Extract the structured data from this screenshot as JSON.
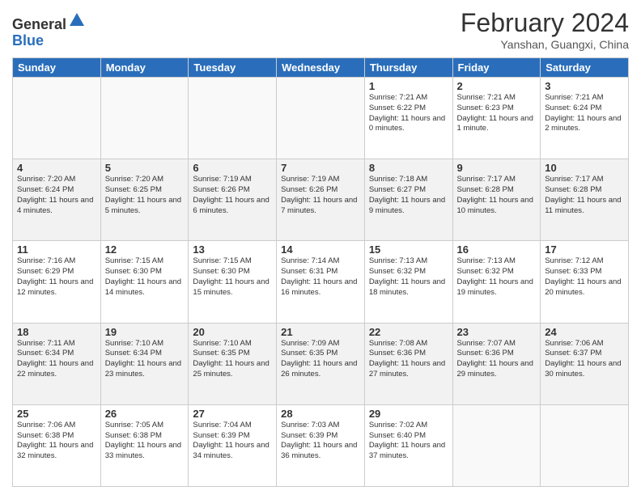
{
  "header": {
    "logo_line1": "General",
    "logo_line2": "Blue",
    "month_title": "February 2024",
    "subtitle": "Yanshan, Guangxi, China"
  },
  "weekdays": [
    "Sunday",
    "Monday",
    "Tuesday",
    "Wednesday",
    "Thursday",
    "Friday",
    "Saturday"
  ],
  "weeks": [
    [
      {
        "day": "",
        "info": ""
      },
      {
        "day": "",
        "info": ""
      },
      {
        "day": "",
        "info": ""
      },
      {
        "day": "",
        "info": ""
      },
      {
        "day": "1",
        "info": "Sunrise: 7:21 AM\nSunset: 6:22 PM\nDaylight: 11 hours and 0 minutes."
      },
      {
        "day": "2",
        "info": "Sunrise: 7:21 AM\nSunset: 6:23 PM\nDaylight: 11 hours and 1 minute."
      },
      {
        "day": "3",
        "info": "Sunrise: 7:21 AM\nSunset: 6:24 PM\nDaylight: 11 hours and 2 minutes."
      }
    ],
    [
      {
        "day": "4",
        "info": "Sunrise: 7:20 AM\nSunset: 6:24 PM\nDaylight: 11 hours and 4 minutes."
      },
      {
        "day": "5",
        "info": "Sunrise: 7:20 AM\nSunset: 6:25 PM\nDaylight: 11 hours and 5 minutes."
      },
      {
        "day": "6",
        "info": "Sunrise: 7:19 AM\nSunset: 6:26 PM\nDaylight: 11 hours and 6 minutes."
      },
      {
        "day": "7",
        "info": "Sunrise: 7:19 AM\nSunset: 6:26 PM\nDaylight: 11 hours and 7 minutes."
      },
      {
        "day": "8",
        "info": "Sunrise: 7:18 AM\nSunset: 6:27 PM\nDaylight: 11 hours and 9 minutes."
      },
      {
        "day": "9",
        "info": "Sunrise: 7:17 AM\nSunset: 6:28 PM\nDaylight: 11 hours and 10 minutes."
      },
      {
        "day": "10",
        "info": "Sunrise: 7:17 AM\nSunset: 6:28 PM\nDaylight: 11 hours and 11 minutes."
      }
    ],
    [
      {
        "day": "11",
        "info": "Sunrise: 7:16 AM\nSunset: 6:29 PM\nDaylight: 11 hours and 12 minutes."
      },
      {
        "day": "12",
        "info": "Sunrise: 7:15 AM\nSunset: 6:30 PM\nDaylight: 11 hours and 14 minutes."
      },
      {
        "day": "13",
        "info": "Sunrise: 7:15 AM\nSunset: 6:30 PM\nDaylight: 11 hours and 15 minutes."
      },
      {
        "day": "14",
        "info": "Sunrise: 7:14 AM\nSunset: 6:31 PM\nDaylight: 11 hours and 16 minutes."
      },
      {
        "day": "15",
        "info": "Sunrise: 7:13 AM\nSunset: 6:32 PM\nDaylight: 11 hours and 18 minutes."
      },
      {
        "day": "16",
        "info": "Sunrise: 7:13 AM\nSunset: 6:32 PM\nDaylight: 11 hours and 19 minutes."
      },
      {
        "day": "17",
        "info": "Sunrise: 7:12 AM\nSunset: 6:33 PM\nDaylight: 11 hours and 20 minutes."
      }
    ],
    [
      {
        "day": "18",
        "info": "Sunrise: 7:11 AM\nSunset: 6:34 PM\nDaylight: 11 hours and 22 minutes."
      },
      {
        "day": "19",
        "info": "Sunrise: 7:10 AM\nSunset: 6:34 PM\nDaylight: 11 hours and 23 minutes."
      },
      {
        "day": "20",
        "info": "Sunrise: 7:10 AM\nSunset: 6:35 PM\nDaylight: 11 hours and 25 minutes."
      },
      {
        "day": "21",
        "info": "Sunrise: 7:09 AM\nSunset: 6:35 PM\nDaylight: 11 hours and 26 minutes."
      },
      {
        "day": "22",
        "info": "Sunrise: 7:08 AM\nSunset: 6:36 PM\nDaylight: 11 hours and 27 minutes."
      },
      {
        "day": "23",
        "info": "Sunrise: 7:07 AM\nSunset: 6:36 PM\nDaylight: 11 hours and 29 minutes."
      },
      {
        "day": "24",
        "info": "Sunrise: 7:06 AM\nSunset: 6:37 PM\nDaylight: 11 hours and 30 minutes."
      }
    ],
    [
      {
        "day": "25",
        "info": "Sunrise: 7:06 AM\nSunset: 6:38 PM\nDaylight: 11 hours and 32 minutes."
      },
      {
        "day": "26",
        "info": "Sunrise: 7:05 AM\nSunset: 6:38 PM\nDaylight: 11 hours and 33 minutes."
      },
      {
        "day": "27",
        "info": "Sunrise: 7:04 AM\nSunset: 6:39 PM\nDaylight: 11 hours and 34 minutes."
      },
      {
        "day": "28",
        "info": "Sunrise: 7:03 AM\nSunset: 6:39 PM\nDaylight: 11 hours and 36 minutes."
      },
      {
        "day": "29",
        "info": "Sunrise: 7:02 AM\nSunset: 6:40 PM\nDaylight: 11 hours and 37 minutes."
      },
      {
        "day": "",
        "info": ""
      },
      {
        "day": "",
        "info": ""
      }
    ]
  ]
}
